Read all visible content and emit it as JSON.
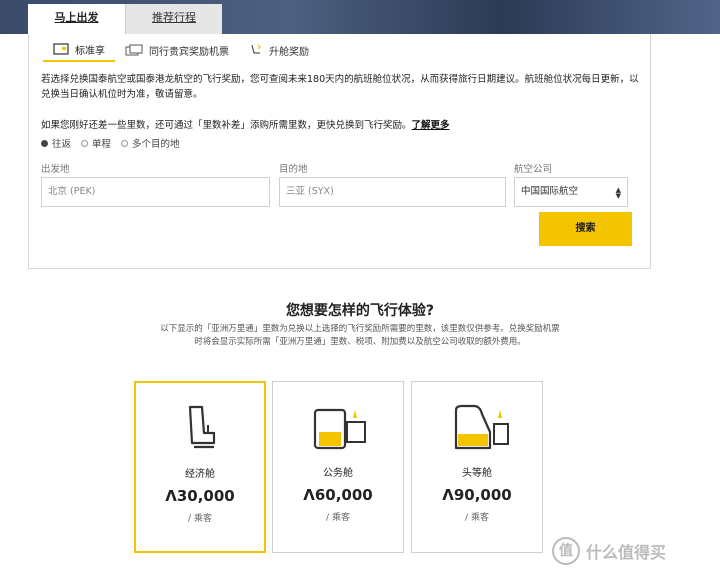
{
  "top_tabs": [
    {
      "label": "马上出发",
      "active": true
    },
    {
      "label": "推荐行程",
      "active": false
    }
  ],
  "sub_tabs": [
    {
      "label": "标准享",
      "icon": "card-icon",
      "active": true
    },
    {
      "label": "同行贵宾奖励机票",
      "icon": "tickets-icon",
      "active": false
    },
    {
      "label": "升舱奖励",
      "icon": "seat-upgrade-icon",
      "active": false
    }
  ],
  "description": "若选择兑换国泰航空或国泰港龙航空的飞行奖励，您可查阅未来180天内的航班舱位状况，从而获得旅行日期建议。航班舱位状况每日更新，以兑换当日确认机位时为准，敬请留意。",
  "tip": {
    "text": "如果您刚好还差一些里数，还可通过「里数补差」添购所需里数，更快兑换到飞行奖励。",
    "link": "了解更多"
  },
  "trip_types": [
    {
      "label": "往返",
      "selected": true
    },
    {
      "label": "单程",
      "selected": false
    },
    {
      "label": "多个目的地",
      "selected": false
    }
  ],
  "form": {
    "origin_label": "出发地",
    "origin_value": "北京 (PEK)",
    "destination_label": "目的地",
    "destination_value": "三亚 (SYX)",
    "airline_label": "航空公司",
    "airline_value": "中国国际航空",
    "search_label": "搜索"
  },
  "section": {
    "title": "您想要怎样的飞行体验?",
    "note_line1": "以下显示的「亚洲万里通」里数为兑换以上选择的飞行奖励所需要的里数，该里数仅供参考。兑换奖励机票",
    "note_line2": "时将会显示实际所需「亚洲万里通」里数、税项、附加费以及航空公司收取的额外费用。"
  },
  "cabins": [
    {
      "name": "经济舱",
      "miles": "Λ30,000",
      "per": "/ 乘客",
      "icon": "economy-seat-icon",
      "selected": true
    },
    {
      "name": "公务舱",
      "miles": "Λ60,000",
      "per": "/ 乘客",
      "icon": "business-seat-icon",
      "selected": false
    },
    {
      "name": "头等舱",
      "miles": "Λ90,000",
      "per": "/ 乘客",
      "icon": "first-class-seat-icon",
      "selected": false
    }
  ],
  "watermark": {
    "logo": "值",
    "text": "什么值得买"
  },
  "colors": {
    "accent": "#f5c400"
  }
}
